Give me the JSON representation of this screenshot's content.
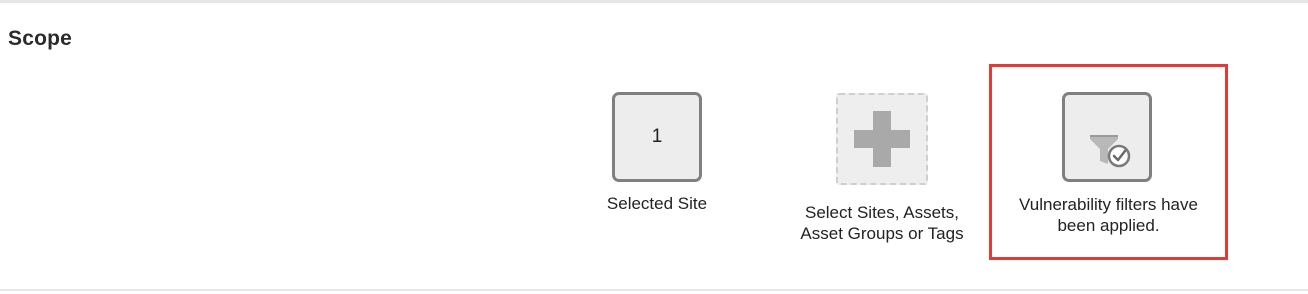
{
  "section": {
    "title": "Scope"
  },
  "scope_items": {
    "selected_site": {
      "count": "1",
      "label": "Selected Site"
    },
    "select_scope": {
      "icon": "plus-icon",
      "label_line1": "Select Sites, Assets,",
      "label_line2": "Asset Groups or Tags"
    },
    "vulnerability_filters": {
      "icon": "filter-check-icon",
      "label_line1": "Vulnerability filters have",
      "label_line2": "been applied."
    }
  },
  "colors": {
    "highlight": "#e53935",
    "tile_border": "#808080",
    "tile_background": "#ededed"
  }
}
